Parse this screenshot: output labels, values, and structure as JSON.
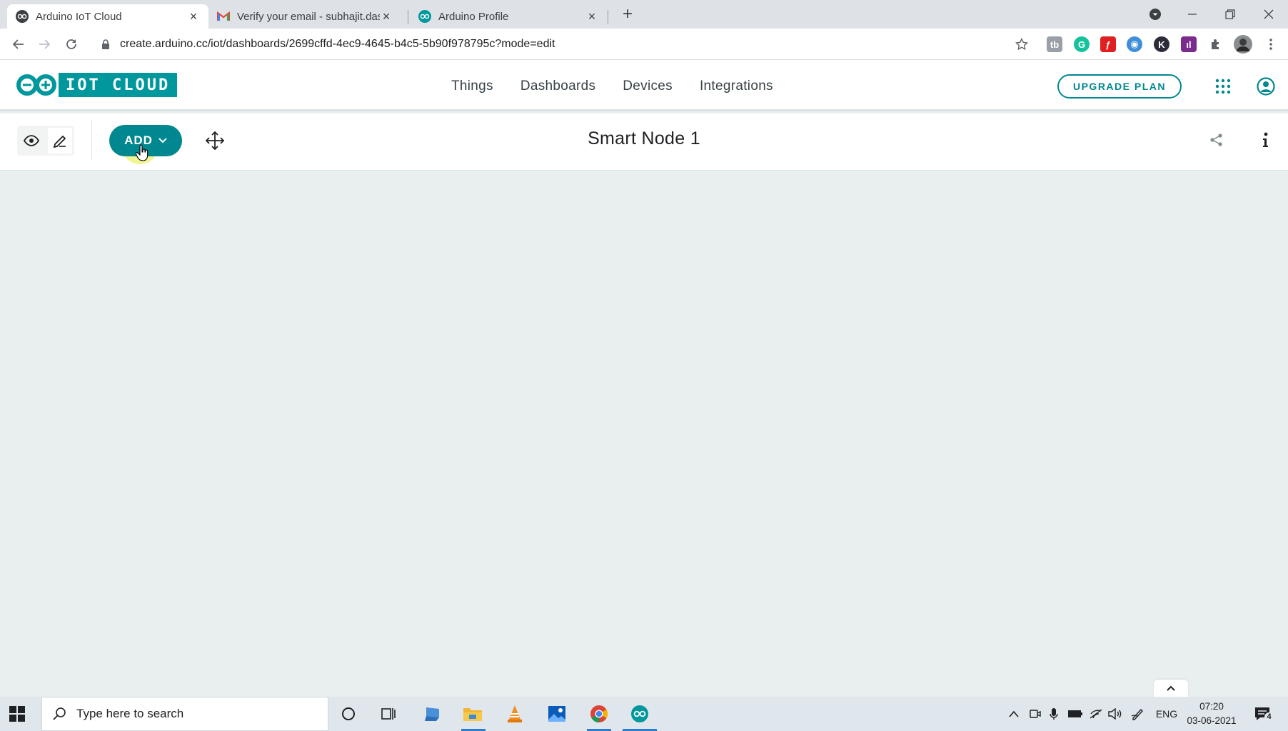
{
  "browser": {
    "tabs": [
      {
        "title": "Arduino IoT Cloud",
        "favicon": "arduino-icon",
        "active": true
      },
      {
        "title": "Verify your email - subhajit.das.sc",
        "favicon": "gmail-icon",
        "active": false
      },
      {
        "title": "Arduino Profile",
        "favicon": "arduino-icon",
        "active": false
      }
    ],
    "url": "create.arduino.cc/iot/dashboards/2699cffd-4ec9-4645-b4c5-5b90f978795c?mode=edit"
  },
  "header": {
    "logo_text": "IOT CLOUD",
    "nav": [
      "Things",
      "Dashboards",
      "Devices",
      "Integrations"
    ],
    "upgrade_label": "UPGRADE PLAN"
  },
  "dashboard": {
    "title": "Smart Node 1",
    "add_label": "ADD",
    "mode": "edit"
  },
  "taskbar": {
    "search_placeholder": "Type here to search",
    "language": "ENG",
    "time": "07:20",
    "date": "03-06-2021",
    "notification_count": "4"
  },
  "colors": {
    "brand": "#00979d",
    "accent": "#00878f",
    "canvas": "#e9eeef"
  }
}
